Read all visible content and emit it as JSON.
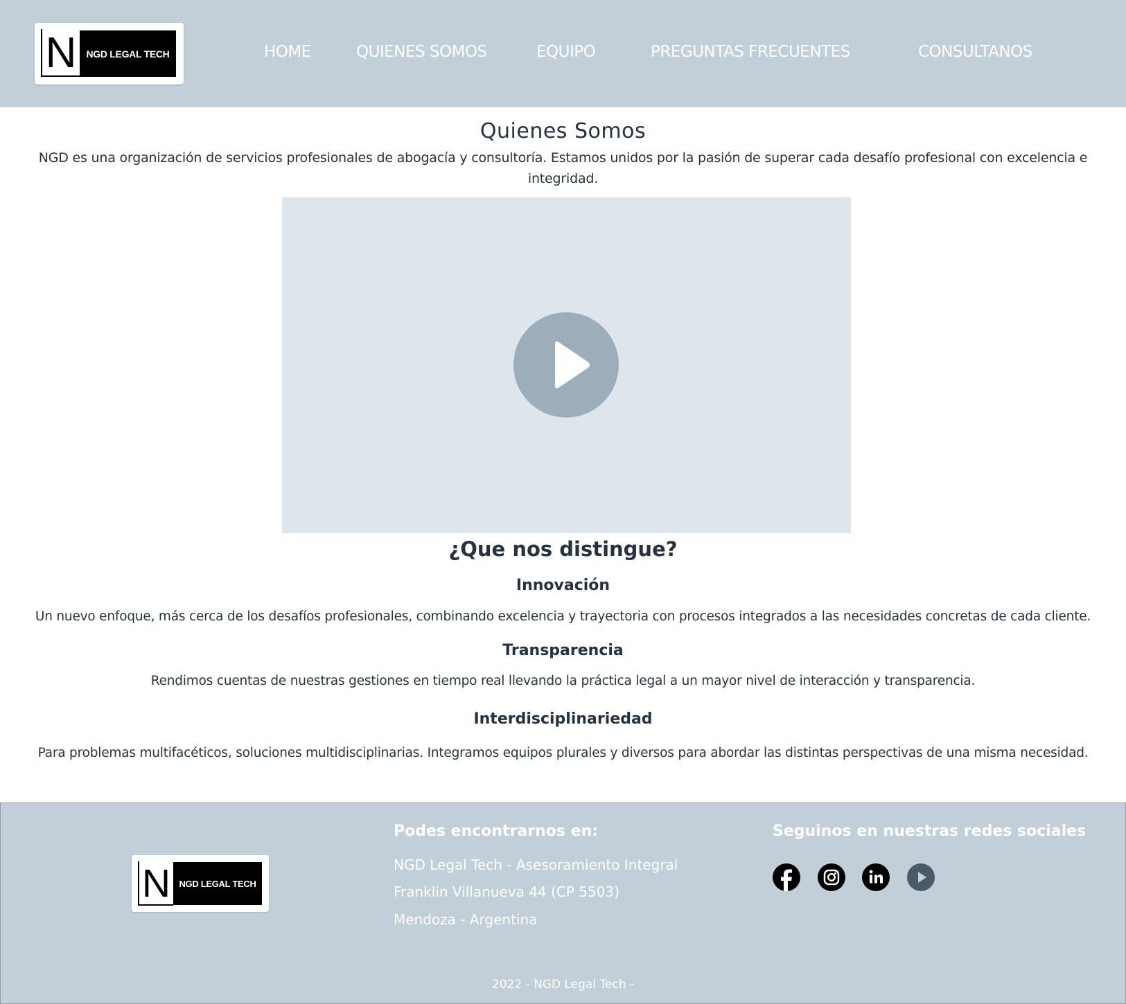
{
  "brand": {
    "logo_text": "NGD LEGAL TECH",
    "logo_letter": "N"
  },
  "nav": [
    {
      "label": "HOME"
    },
    {
      "label": "QUIENES SOMOS"
    },
    {
      "label": "EQUIPO"
    },
    {
      "label": "PREGUNTAS FRECUENTES"
    },
    {
      "label": "CONSULTANOS"
    }
  ],
  "about": {
    "title": "Quienes Somos",
    "intro": "NGD es una organización de servicios profesionales de abogacía y consultoría. Estamos unidos por la pasión de superar cada desafío profesional con excelencia e integridad."
  },
  "video": {
    "play_icon": "play-icon"
  },
  "distinct": {
    "title": "¿Que nos distingue?",
    "items": [
      {
        "heading": "Innovación",
        "text": "Un nuevo enfoque, más cerca de los desafíos profesionales, combinando excelencia y trayectoria con procesos integrados a las necesidades concretas de cada cliente."
      },
      {
        "heading": "Transparencia",
        "text": "Rendimos cuentas de nuestras gestiones en tiempo real llevando la práctica legal a un mayor nivel de interacción y transparencia."
      },
      {
        "heading": "Interdisciplinariedad",
        "text": "Para problemas multifacéticos, soluciones multidisciplinarias. Integramos equipos plurales y diversos para abordar las distintas perspectivas de una misma necesidad."
      }
    ]
  },
  "footer": {
    "find_us_title": "Podes encontrarnos en:",
    "address_lines": [
      "NGD Legal Tech - Asesoramiento Integral",
      "Franklin Villanueva 44 (CP 5503)",
      "Mendoza - Argentina"
    ],
    "social_title": "Seguinos en nuestras redes sociales",
    "social_icons": [
      "facebook-icon",
      "instagram-icon",
      "linkedin-icon",
      "youtube-icon"
    ],
    "copyright": "2022 - NGD Legal Tech -"
  },
  "colors": {
    "header_bg": "#c2cfd8",
    "text": "#253341",
    "video_bg": "#dfe5ec",
    "play_button": "#9eadba"
  }
}
